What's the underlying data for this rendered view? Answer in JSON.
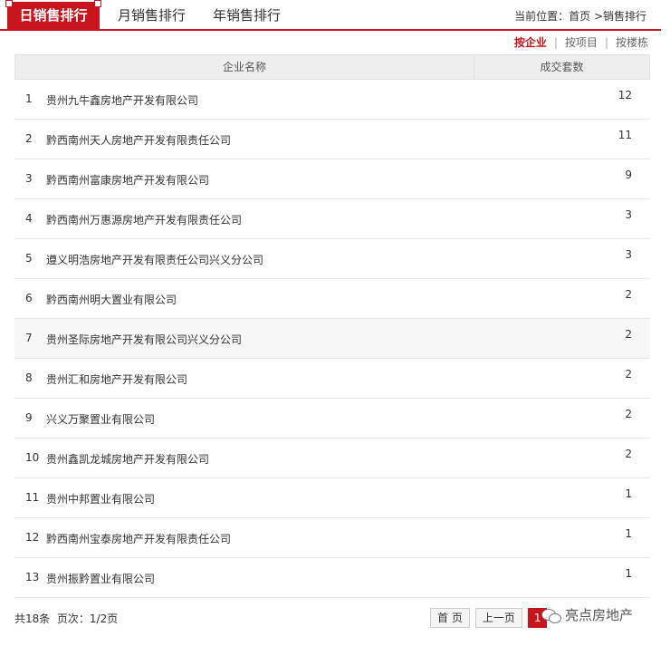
{
  "tabs": [
    "日销售排行",
    "月销售排行",
    "年销售排行"
  ],
  "breadcrumb": "当前位置：首页 >销售排行",
  "sort": {
    "by_company": "按企业",
    "by_project": "按项目",
    "by_building": "按楼栋",
    "separator": "|"
  },
  "table": {
    "headers": [
      "企业名称",
      "成交套数"
    ],
    "rows": [
      {
        "rank": "1",
        "name": "贵州九牛鑫房地产开发有限公司",
        "count": "12"
      },
      {
        "rank": "2",
        "name": "黔西南州天人房地产开发有限责任公司",
        "count": "11"
      },
      {
        "rank": "3",
        "name": "黔西南州富康房地产开发有限公司",
        "count": "9"
      },
      {
        "rank": "4",
        "name": "黔西南州万惠源房地产开发有限责任公司",
        "count": "3"
      },
      {
        "rank": "5",
        "name": "遵义明浩房地产开发有限责任公司兴义分公司",
        "count": "3"
      },
      {
        "rank": "6",
        "name": "黔西南州明大置业有限公司",
        "count": "2"
      },
      {
        "rank": "7",
        "name": "贵州圣际房地产开发有限公司兴义分公司",
        "count": "2"
      },
      {
        "rank": "8",
        "name": "贵州汇和房地产开发有限公司",
        "count": "2"
      },
      {
        "rank": "9",
        "name": "兴义万聚置业有限公司",
        "count": "2"
      },
      {
        "rank": "10",
        "name": "贵州鑫凯龙城房地产开发有限公司",
        "count": "2"
      },
      {
        "rank": "11",
        "name": "贵州中邦置业有限公司",
        "count": "1"
      },
      {
        "rank": "12",
        "name": "黔西南州宝泰房地产开发有限责任公司",
        "count": "1"
      },
      {
        "rank": "13",
        "name": "贵州振黔置业有限公司",
        "count": "1"
      }
    ]
  },
  "footer": {
    "total": "共18条",
    "pages": "页次：1/2页"
  },
  "pager": {
    "first": "首 页",
    "prev": "上一页",
    "current": "1"
  },
  "watermark": {
    "text": "亮点房地产",
    "icon": "wechat-icon"
  },
  "colors": {
    "accent": "#c8151d"
  }
}
